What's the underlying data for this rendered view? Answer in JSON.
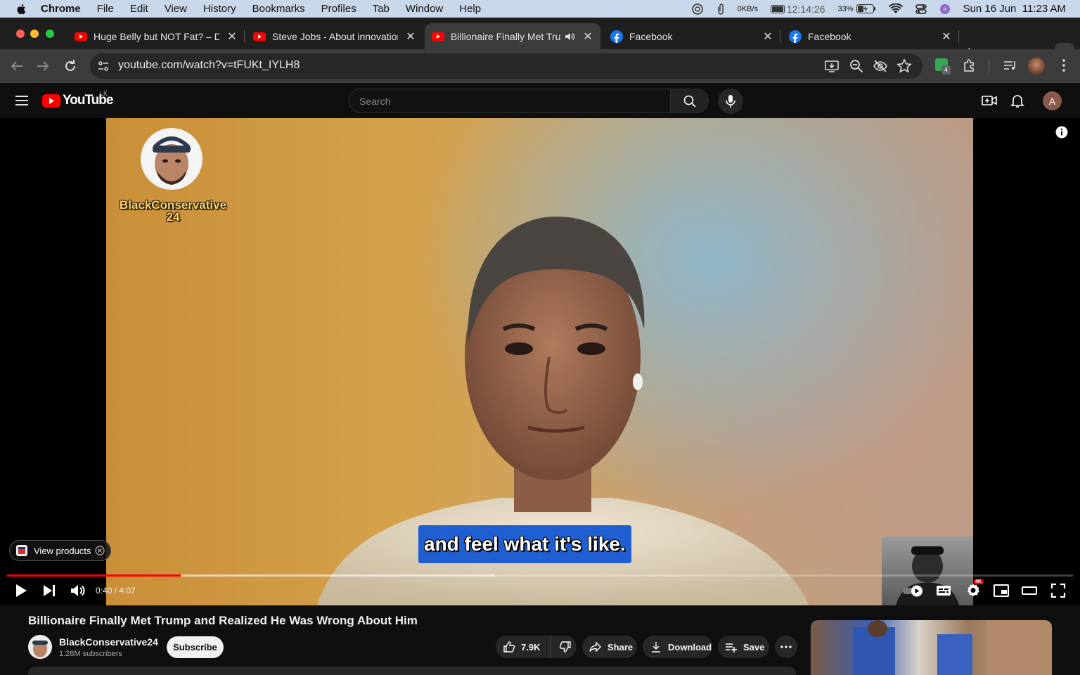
{
  "menubar": {
    "app": "Chrome",
    "items": [
      "File",
      "Edit",
      "View",
      "History",
      "Bookmarks",
      "Profiles",
      "Tab",
      "Window",
      "Help"
    ],
    "net_speed": "0KB/s",
    "battery_timer": "12:14:26",
    "battery_percent": "33%",
    "datetime": "Sun 16 Jun  11:23 AM"
  },
  "tabs": [
    {
      "title": "Huge Belly but NOT Fat? – Dr",
      "favicon": "youtube-icon"
    },
    {
      "title": "Steve Jobs - About innovation",
      "favicon": "youtube-icon"
    },
    {
      "title": "Billionaire Finally Met Trump",
      "favicon": "youtube-icon",
      "active": true
    },
    {
      "title": "Facebook",
      "favicon": "facebook-icon"
    },
    {
      "title": "Facebook",
      "favicon": "facebook-icon"
    }
  ],
  "omnibox": {
    "url": "youtube.com/watch?v=tFUKt_IYLH8"
  },
  "extensions_badge": "4",
  "youtube": {
    "logo": "YouTube",
    "region": "LK",
    "search_placeholder": "Search",
    "account_initial": "A"
  },
  "player": {
    "watermark": "BlackConservative\n24",
    "caption": "and feel what it's like.",
    "view_products": "View products",
    "time": "0:40 / 4:07",
    "played_fraction": 0.163,
    "buffered_fraction": 0.458,
    "quality_badge": "4K"
  },
  "video": {
    "title": "Billionaire Finally Met Trump and Realized He Was Wrong About Him",
    "channel": "BlackConservative24",
    "subscribers": "1.28M subscribers",
    "subscribe_label": "Subscribe",
    "likes": "7.9K",
    "share_label": "Share",
    "download_label": "Download",
    "save_label": "Save"
  },
  "colors": {
    "accent": "#ff0000",
    "caption_bg": "#1f5fd1"
  }
}
